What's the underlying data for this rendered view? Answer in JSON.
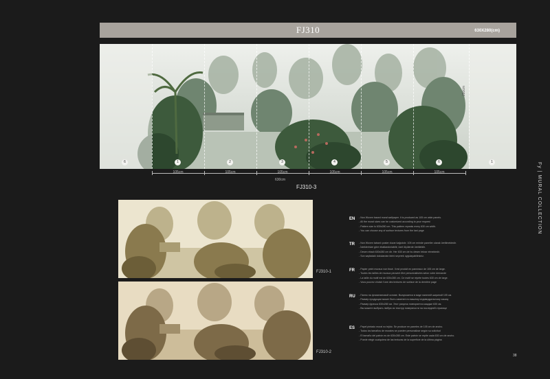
{
  "header": {
    "title": "FJ310",
    "size": "630X280(cm)"
  },
  "panorama": {
    "panel_numbers": [
      "6",
      "1",
      "2",
      "3",
      "4",
      "5",
      "6",
      "1"
    ],
    "height_label": "280cm",
    "widths": [
      "105cm",
      "105cm",
      "105cm",
      "105cm",
      "105cm",
      "105cm"
    ],
    "total_width": "630cm",
    "caption": "FJ310-3"
  },
  "side_brand": "Fy | MURAL COLLECTION",
  "variants": [
    {
      "label": "FJ310-1"
    },
    {
      "label": "FJ310-2"
    }
  ],
  "texts": [
    {
      "lang": "EN",
      "lines": [
        "- Non Woven based mural wallpaper. It is produced as 105 cm wide panels.",
        "- All the mural sizes can be customized according to your request",
        "- Pattern size is 630x280 cm. This pattern repeats every 630 cm width.",
        "- You can choose any of surface textures from the last page"
      ]
    },
    {
      "lang": "TR",
      "lines": [
        "- Non Woven tabanlı poster duvar kağıdıdır. 105 cm eninde paneller olarak üretilmektedir.",
        "- İsteklerinize göre ebatlandırılabilir, özel ölçülerde üretilebilir.",
        "- Desen ebadı 630x280 cm dir. Her 630 cm de bu desen tekrar etmektedir.",
        "- Son sayfadaki dokulardan birini seçerek uygulayabilirsiniz."
      ]
    },
    {
      "lang": "FR",
      "lines": [
        "- Papier peint muraux non tissé. Il est produit en panneaux de 105 cm de large.",
        "- Toutes les tailles de muraux peuvent être personnalisées selon votre demande",
        "- La taille du motif est de 630x280 cm. Ce motif se répète toutes 630 cm de large.",
        "- Vous pouvez choisir l'une des textures de surface de la dernière page"
      ]
    },
    {
      "lang": "RU",
      "lines": [
        "- Панно на флизелиновой основе. Выпускается в виде панелей шириной 105 см.",
        "- Размер продукции может быть изменен по вашему индивидуальному заказу",
        "- Размер фреска 630x280 см. Этот рисунок повторяется каждые 630 см.",
        "- Вы можете выбрать любую из текстур поверхности на последней странице"
      ]
    },
    {
      "lang": "ES",
      "lines": [
        "- Papel pintado mural no tejido. Se produce en paneles de 105 cm de ancho.",
        "- Todos los tamaños de murales se pueden personalizar según su solicitud",
        "- El tamaño del patrón es de 630x280 cm. Este patrón se repite cada 630 cm de ancho.",
        "- Puede elegir cualquiera de las texturas de la superficie de la última página"
      ]
    }
  ],
  "page_number": "38",
  "colors": {
    "background": "#1b1b1b",
    "title_bar": "#a8a39d",
    "foliage": "#3d5a3c",
    "sepia": "#8a7a4e"
  }
}
